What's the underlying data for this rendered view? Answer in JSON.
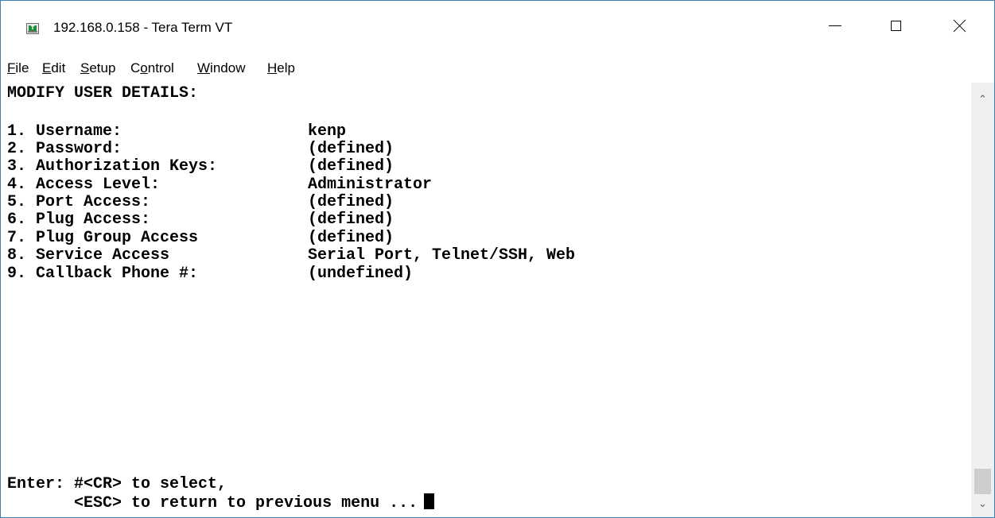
{
  "window": {
    "title": "192.168.0.158 - Tera Term VT",
    "icon": "tera-term-app-icon",
    "icon_glyph": "T",
    "controls": {
      "minimize_icon": "minimize-icon",
      "maximize_icon": "maximize-icon",
      "close_icon": "close-icon"
    }
  },
  "menu": {
    "items": [
      {
        "accel": "F",
        "rest": "ile",
        "label": "File"
      },
      {
        "accel": "E",
        "rest": "dit",
        "label": "Edit"
      },
      {
        "accel": "S",
        "rest": "etup",
        "label": "Setup"
      },
      {
        "pre": "C",
        "accel": "o",
        "rest": "ntrol",
        "label": "Control"
      },
      {
        "accel": "W",
        "rest": "indow",
        "label": "Window"
      },
      {
        "accel": "H",
        "rest": "elp",
        "label": "Help"
      }
    ]
  },
  "terminal": {
    "heading": "MODIFY USER DETAILS:",
    "fields": [
      {
        "label": "1. Username:",
        "value": "kenp"
      },
      {
        "label": "2. Password:",
        "value": "(defined)"
      },
      {
        "label": "3. Authorization Keys:",
        "value": "(defined)"
      },
      {
        "label": "4. Access Level:",
        "value": "Administrator"
      },
      {
        "label": "5. Port Access:",
        "value": "(defined)"
      },
      {
        "label": "6. Plug Access:",
        "value": "(defined)"
      },
      {
        "label": "7. Plug Group Access",
        "value": "(defined)"
      },
      {
        "label": "8. Service Access",
        "value": "Serial Port, Telnet/SSH, Web"
      },
      {
        "label": "9. Callback Phone #:",
        "value": "(undefined)"
      }
    ],
    "prompt_line1": "Enter: #<CR> to select,",
    "prompt_line2": "       <ESC> to return to previous menu ..."
  },
  "scrollbar": {
    "up_icon": "scroll-up-arrow-icon",
    "down_icon": "scroll-down-arrow-icon",
    "position": 1.0
  },
  "colors": {
    "window_border": "#3c7fb1",
    "terminal_bg": "#ffffff",
    "terminal_fg": "#000000"
  }
}
